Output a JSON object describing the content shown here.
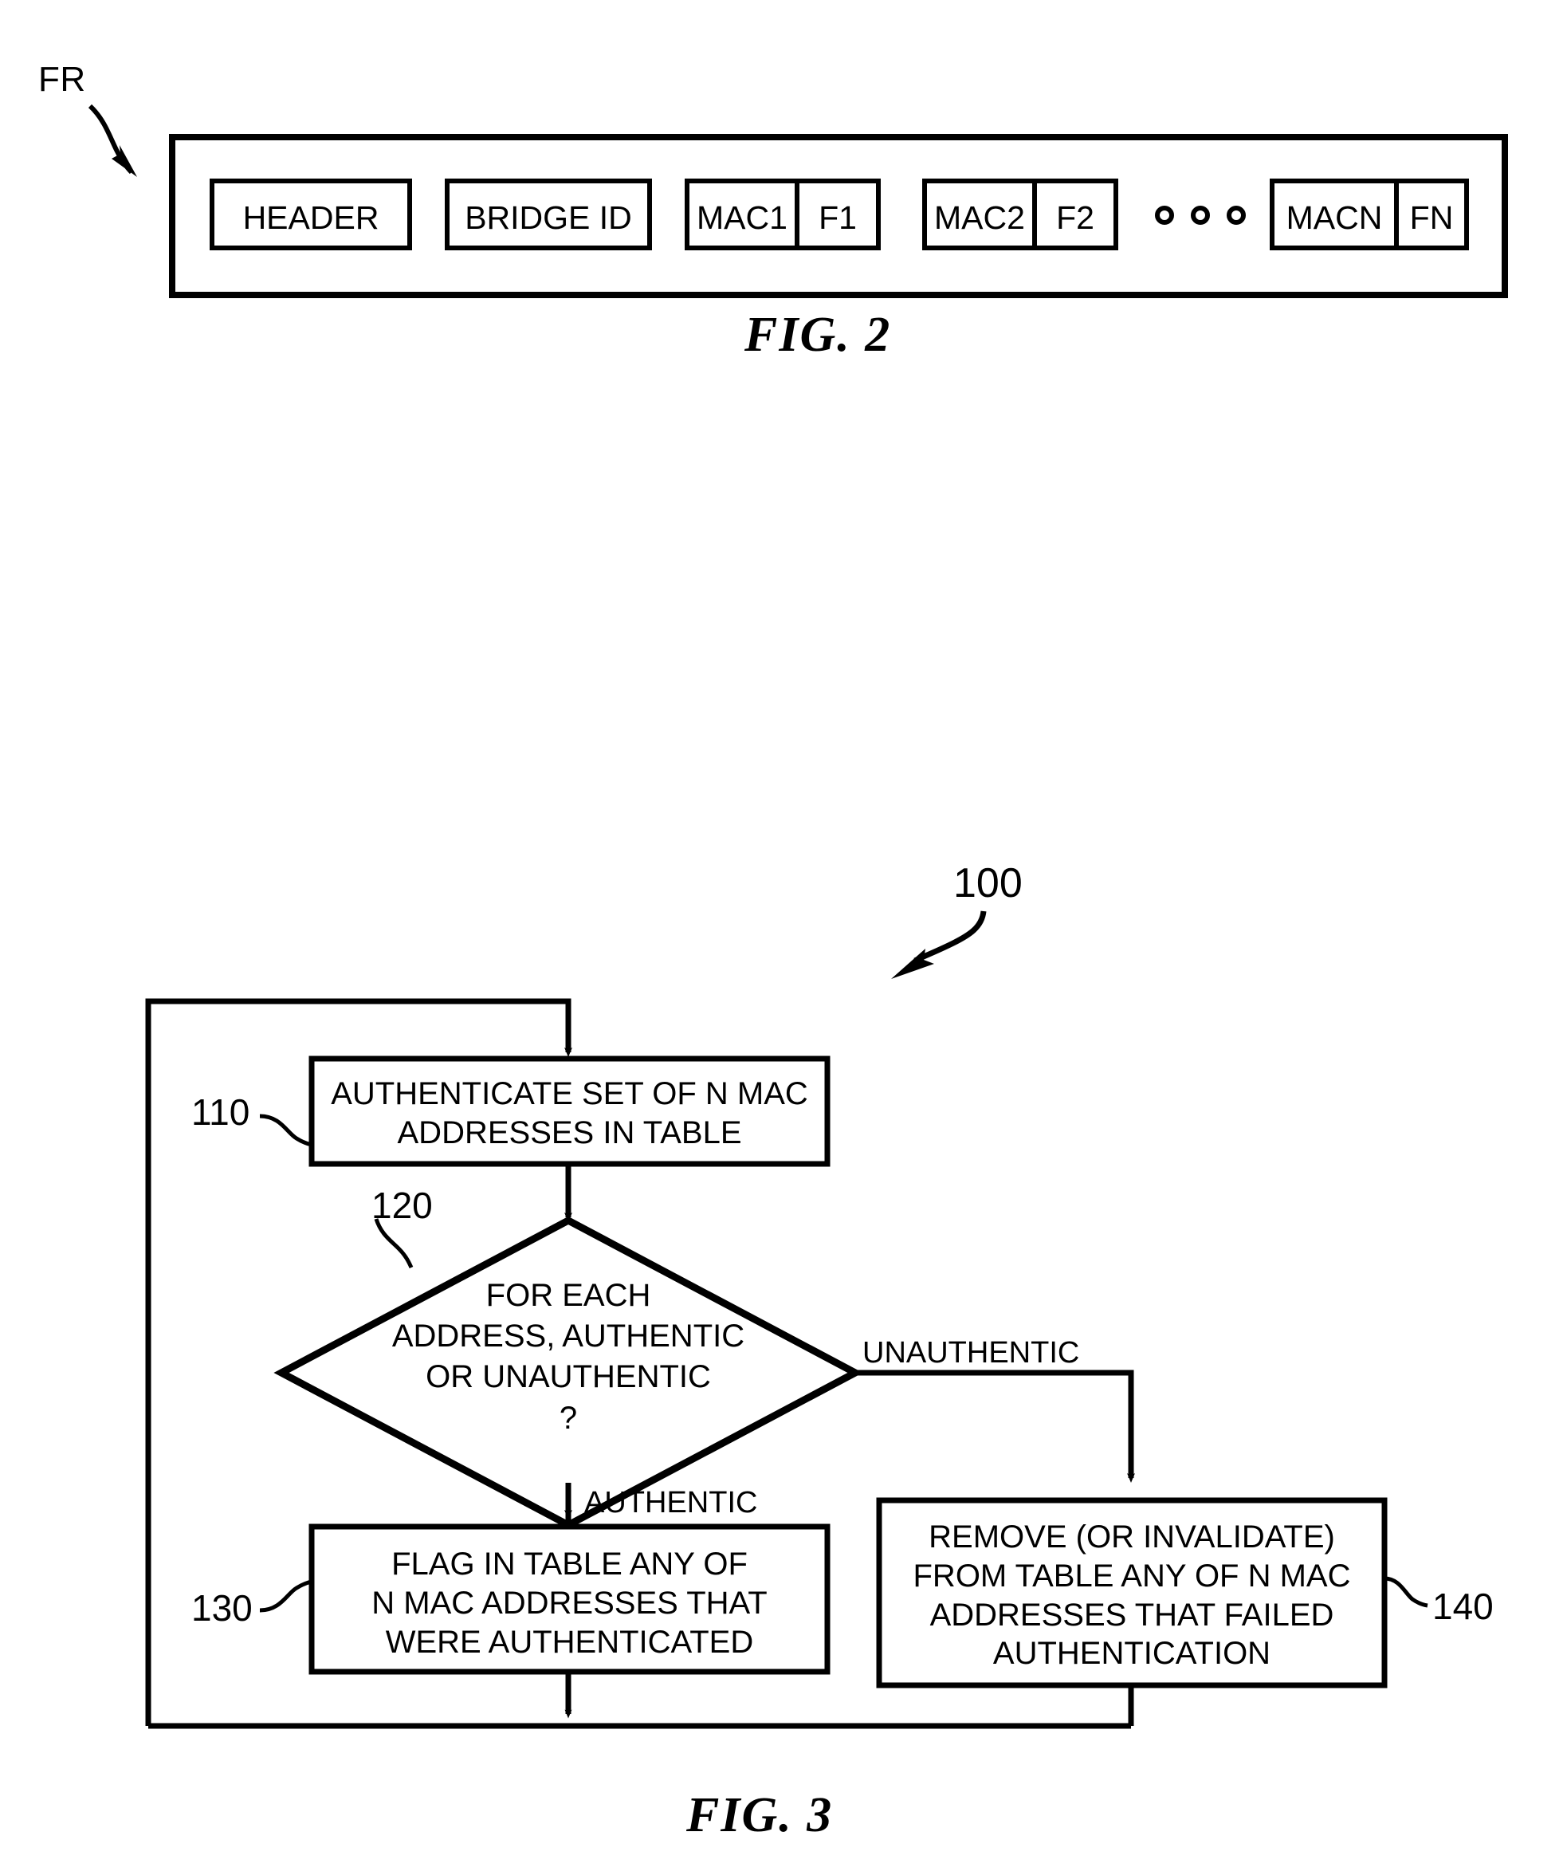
{
  "document": {
    "kind": "patent-drawing-sheet",
    "ink_color": "#000000",
    "background_color": "#ffffff"
  },
  "fig2": {
    "caption": "FIG. 2",
    "frame_label": "FR",
    "fields": [
      {
        "name": "header-field",
        "label": "HEADER",
        "split": false
      },
      {
        "name": "bridge-id-field",
        "label": "BRIDGE ID",
        "split": false
      },
      {
        "name": "mac1-flag1-field",
        "label": "MAC1",
        "flag": "F1",
        "split": true
      },
      {
        "name": "mac2-flag2-field",
        "label": "MAC2",
        "flag": "F2",
        "split": true
      },
      {
        "name": "macn-flagn-field",
        "label": "MACN",
        "flag": "FN",
        "split": true
      }
    ],
    "ellipsis": "o o o"
  },
  "fig3": {
    "caption": "FIG. 3",
    "flow_label": "100",
    "steps": [
      {
        "ref": "110",
        "shape": "process",
        "text": "AUTHENTICATE SET OF N MAC\nADDRESSES IN TABLE"
      },
      {
        "ref": "120",
        "shape": "decision",
        "text": "FOR EACH\nADDRESS, AUTHENTIC\nOR UNAUTHENTIC\n?"
      },
      {
        "ref": "130",
        "shape": "process",
        "text": "FLAG IN TABLE ANY OF\nN MAC ADDRESSES THAT\nWERE AUTHENTICATED"
      },
      {
        "ref": "140",
        "shape": "process",
        "text": "REMOVE (OR INVALIDATE)\nFROM TABLE ANY OF N MAC\nADDRESSES THAT FAILED\nAUTHENTICATION"
      }
    ],
    "branches": {
      "unauthentic_label": "UNAUTHENTIC",
      "authentic_label": "AUTHENTIC"
    }
  }
}
